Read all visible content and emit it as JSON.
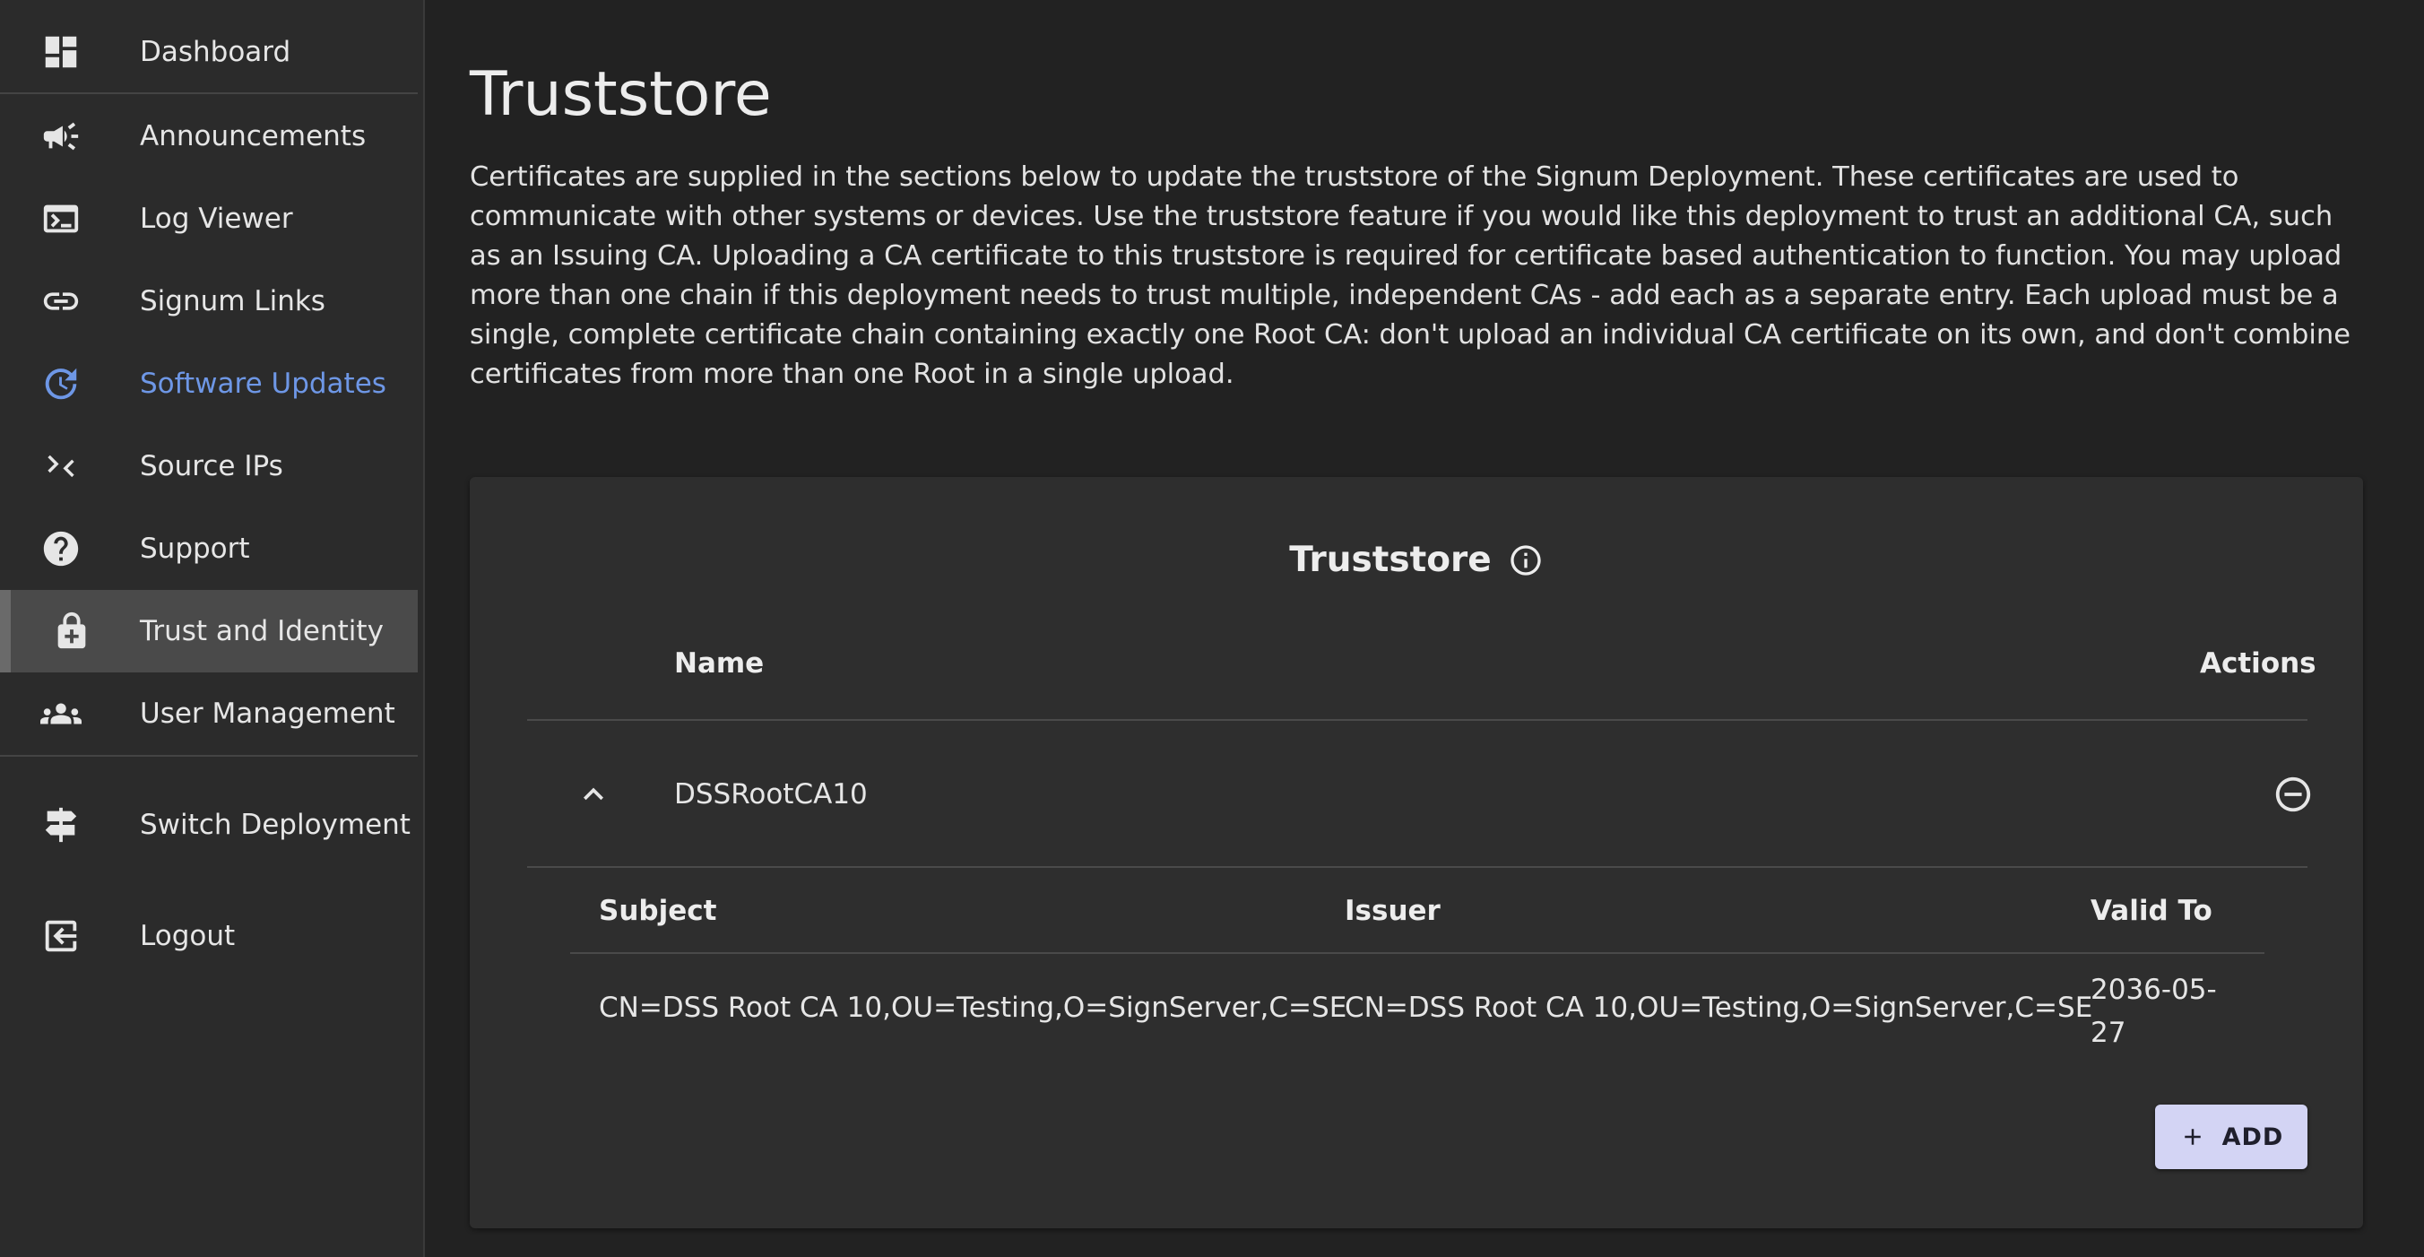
{
  "sidebar": {
    "items": [
      {
        "label": "Dashboard",
        "icon": "dashboard-icon"
      },
      {
        "label": "Announcements",
        "icon": "megaphone-icon"
      },
      {
        "label": "Log Viewer",
        "icon": "terminal-icon"
      },
      {
        "label": "Signum Links",
        "icon": "link-icon"
      },
      {
        "label": "Software Updates",
        "icon": "update-icon"
      },
      {
        "label": "Source IPs",
        "icon": "compress-arrows-icon"
      },
      {
        "label": "Support",
        "icon": "help-circle-icon"
      },
      {
        "label": "Trust and Identity",
        "icon": "lock-plus-icon"
      },
      {
        "label": "User Management",
        "icon": "group-icon"
      }
    ],
    "switch_deployment": {
      "label": "Switch Deployment",
      "icon": "signpost-icon"
    },
    "logout": {
      "label": "Logout",
      "icon": "logout-icon"
    }
  },
  "main": {
    "title": "Truststore",
    "description": "Certificates are supplied in the sections below to update the truststore of the Signum Deployment. These certificates are used to communicate with other systems or devices. Use the truststore feature if you would like this deployment to trust an additional CA, such as an Issuing CA. Uploading a CA certificate to this truststore is required for certificate based authentication to function. You may upload more than one chain if this deployment needs to trust multiple, independent CAs - add each as a separate entry. Each upload must be a single, complete certificate chain containing exactly one Root CA: don't upload an individual CA certificate on its own, and don't combine certificates from more than one Root in a single upload."
  },
  "truststore": {
    "title": "Truststore",
    "columns": {
      "name": "Name",
      "actions": "Actions"
    },
    "entries": [
      {
        "name": "DSSRootCA10",
        "expanded": true,
        "cert_columns": {
          "subject": "Subject",
          "issuer": "Issuer",
          "valid_to": "Valid To"
        },
        "certificates": [
          {
            "subject": "CN=DSS Root CA 10,OU=Testing,O=SignServer,C=SE",
            "issuer": "CN=DSS Root CA 10,OU=Testing,O=SignServer,C=SE",
            "valid_to": "2036-05-27"
          }
        ]
      }
    ],
    "add_label": "ADD"
  },
  "colors": {
    "background": "#222222",
    "sidebar": "#2b2b2b",
    "card": "#2e2e2e",
    "active_link": "#6e97e6",
    "selected_item": "#4a4a4a",
    "add_button": "#d3d4f4"
  }
}
